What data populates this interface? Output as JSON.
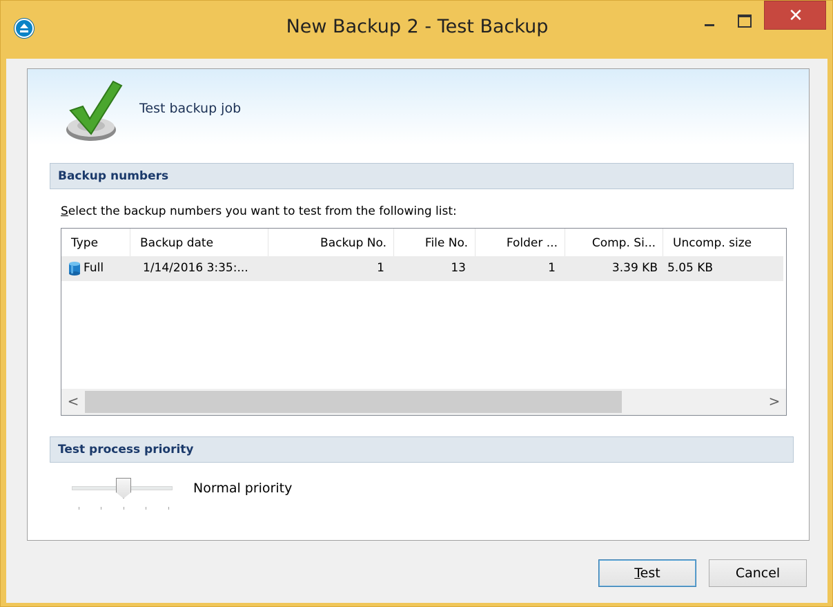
{
  "window": {
    "title": "New Backup 2 - Test Backup",
    "close_symbol": "✕",
    "colors": {
      "frame": "#f0c659",
      "close": "#c7483f",
      "accent": "#1b3a6b"
    }
  },
  "header": {
    "title": "Test backup job",
    "icon": "checkmark-icon"
  },
  "sections": {
    "backup_numbers": "Backup numbers",
    "priority": "Test process priority"
  },
  "instruction": {
    "first_letter": "S",
    "rest": "elect the backup numbers you want to test from the following list:"
  },
  "table": {
    "columns": [
      "Type",
      "Backup date",
      "Backup No.",
      "File No.",
      "Folder ...",
      "Comp. Si...",
      "Uncomp. size"
    ],
    "rows": [
      {
        "type": "Full",
        "date": "1/14/2016 3:35:...",
        "backup_no": "1",
        "file_no": "13",
        "folder": "1",
        "comp_size": "3.39 KB",
        "uncomp_size": "5.05 KB"
      }
    ],
    "scroll_left": "<",
    "scroll_right": ">"
  },
  "priority": {
    "label": "Normal priority",
    "level": 3,
    "levels": 5
  },
  "buttons": {
    "test": {
      "mnemonic": "T",
      "rest": "est"
    },
    "cancel": "Cancel"
  }
}
